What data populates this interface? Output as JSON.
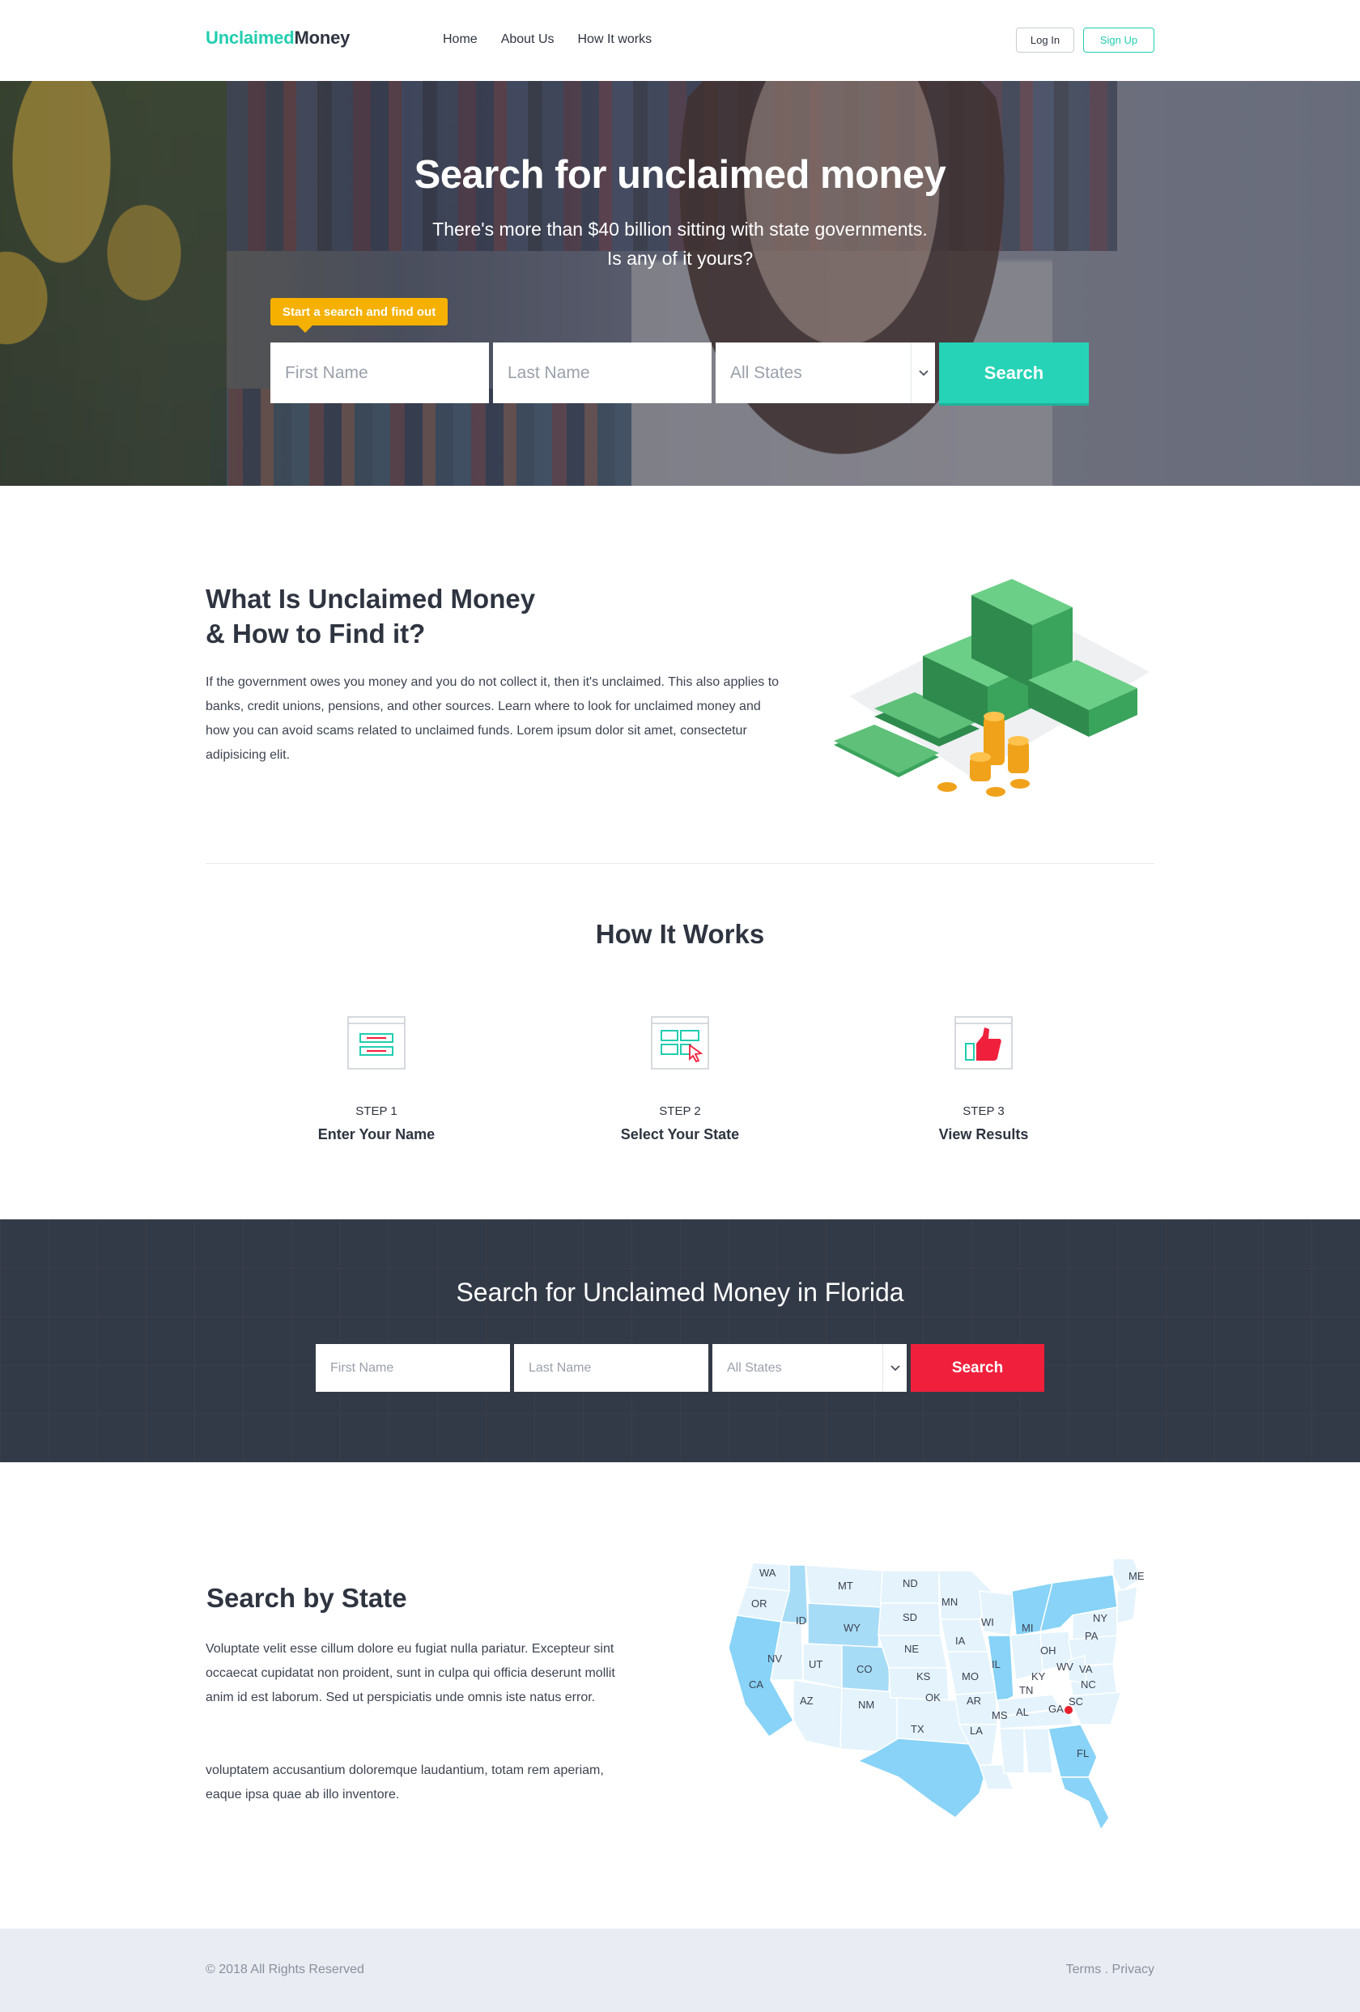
{
  "header": {
    "logo_part1": "Unclaimed",
    "logo_part2": "Money",
    "nav": [
      "Home",
      "About Us",
      "How It works"
    ],
    "login_label": "Log In",
    "signup_label": "Sign Up"
  },
  "hero": {
    "title": "Search for unclaimed money",
    "subtitle_line1": "There's more than $40 billion sitting with state governments.",
    "subtitle_line2": "Is any of it yours?",
    "tip": "Start a search and find out",
    "first_placeholder": "First Name",
    "last_placeholder": "Last Name",
    "state_selected": "All States",
    "search_label": "Search"
  },
  "about": {
    "title_line1": "What Is Unclaimed Money",
    "title_line2": "& How to Find it?",
    "paragraph": "If the government owes you money and you do not collect it, then it's unclaimed. This also applies to banks, credit unions, pensions, and other sources. Learn where to look for unclaimed money and how you can avoid scams related to unclaimed funds. Lorem ipsum dolor sit amet, consectetur adipisicing elit."
  },
  "how_it_works": {
    "title": "How It Works",
    "steps": [
      {
        "label": "STEP 1",
        "name": "Enter Your Name",
        "icon": "form-icon"
      },
      {
        "label": "STEP 2",
        "name": "Select Your State",
        "icon": "select-grid-icon"
      },
      {
        "label": "STEP 3",
        "name": "View Results",
        "icon": "thumbs-up-icon"
      }
    ]
  },
  "florida_search": {
    "title": "Search for Unclaimed Money in Florida",
    "first_placeholder": "First Name",
    "last_placeholder": "Last Name",
    "state_selected": "All States",
    "search_label": "Search"
  },
  "state_section": {
    "title": "Search by State",
    "paragraph1": "Voluptate velit esse cillum dolore eu fugiat nulla pariatur. Excepteur sint occaecat cupidatat non proident, sunt in culpa qui officia deserunt mollit anim id est laborum. Sed ut perspiciatis unde omnis iste natus error.",
    "paragraph2": "voluptatem accusantium doloremque laudantium, totam rem aperiam, eaque ipsa quae ab illo inventore.",
    "map_labels": [
      "WA",
      "OR",
      "MT",
      "ND",
      "MN",
      "ID",
      "SD",
      "WI",
      "MI",
      "NY",
      "ME",
      "WY",
      "NE",
      "IA",
      "PA",
      "NV",
      "UT",
      "CO",
      "KS",
      "IL",
      "OH",
      "WV",
      "VA",
      "CA",
      "MO",
      "KY",
      "NC",
      "TN",
      "SC",
      "AZ",
      "NM",
      "OK",
      "AR",
      "MS",
      "AL",
      "GA",
      "TX",
      "LA",
      "FL"
    ],
    "highlight_state": "SC"
  },
  "footer": {
    "copyright": "© 2018  All Rights Reserved",
    "links": "Terms . Privacy"
  },
  "colors": {
    "accent": "#22cdb0",
    "tip": "#f5b000",
    "dark_bg": "#333a47",
    "red_button": "#f0203c",
    "map_highlight": "#88d3f7"
  }
}
